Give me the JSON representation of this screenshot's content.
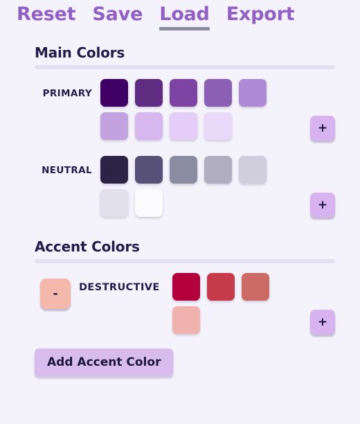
{
  "nav": {
    "items": [
      {
        "label": "Reset",
        "active": false
      },
      {
        "label": "Save",
        "active": false
      },
      {
        "label": "Load",
        "active": true
      },
      {
        "label": "Export",
        "active": false
      }
    ]
  },
  "main_section": {
    "title": "Main Colors",
    "groups": [
      {
        "label": "PRIMARY",
        "add_label": "+",
        "colors": [
          "#3f0066",
          "#5e2d82",
          "#7e44a3",
          "#8b5fb4",
          "#ae8bd4",
          "#c2a3e0",
          "#d6b8ef",
          "#e4cdf6",
          "#ead9f8"
        ]
      },
      {
        "label": "NEUTRAL",
        "add_label": "+",
        "colors": [
          "#2b2447",
          "#585177",
          "#8b8ca2",
          "#b0aebe",
          "#d0cedc",
          "#e2e0ec",
          "#fbfbfd"
        ]
      }
    ]
  },
  "accent_section": {
    "title": "Accent Colors",
    "groups": [
      {
        "label": "DESTRUCTIVE",
        "remove_label": "-",
        "add_label": "+",
        "colors": [
          "#b3003c",
          "#c73a4c",
          "#cc6a66",
          "#f0b2ae"
        ]
      }
    ]
  },
  "footer": {
    "add_accent_label": "Add Accent Color"
  },
  "theme": {
    "background": "#f4f2fb",
    "nav_color": "#9160c4",
    "nav_underline": "#8a8aa0",
    "heading_color": "#231b4a",
    "rule_color": "#e2dff1",
    "add_button_bg": "#d7b4f0",
    "remove_button_bg": "#f4b8ad",
    "footer_button_bg": "#d8bcee"
  }
}
